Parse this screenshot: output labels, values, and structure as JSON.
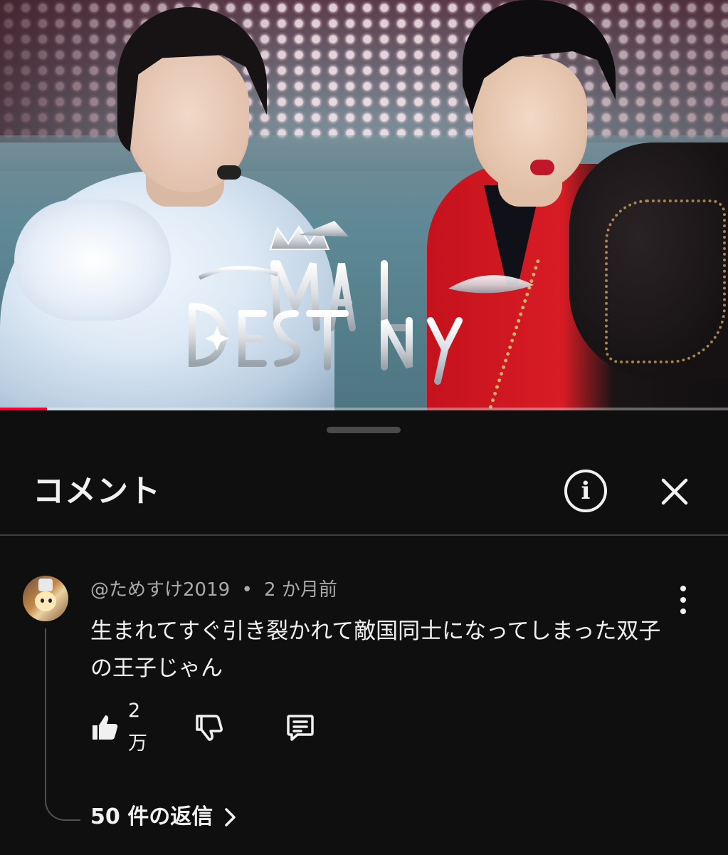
{
  "video": {
    "progress_fraction": 0.065,
    "colors": {
      "progress": "#ff0033"
    }
  },
  "comments_panel": {
    "title": "コメント",
    "info_icon": "info-icon",
    "close_icon": "close-icon"
  },
  "comment": {
    "author": "@ためすけ2019",
    "separator": "•",
    "time": "2 か月前",
    "text": "生まれてすぐ引き裂かれて敵国同士になってしまった双子の王子じゃん",
    "like_count": "2万",
    "icons": {
      "like": "thumbs-up-icon",
      "dislike": "thumbs-down-icon",
      "reply": "comment-icon",
      "menu": "more-vertical-icon"
    },
    "replies_label": "50 件の返信"
  }
}
